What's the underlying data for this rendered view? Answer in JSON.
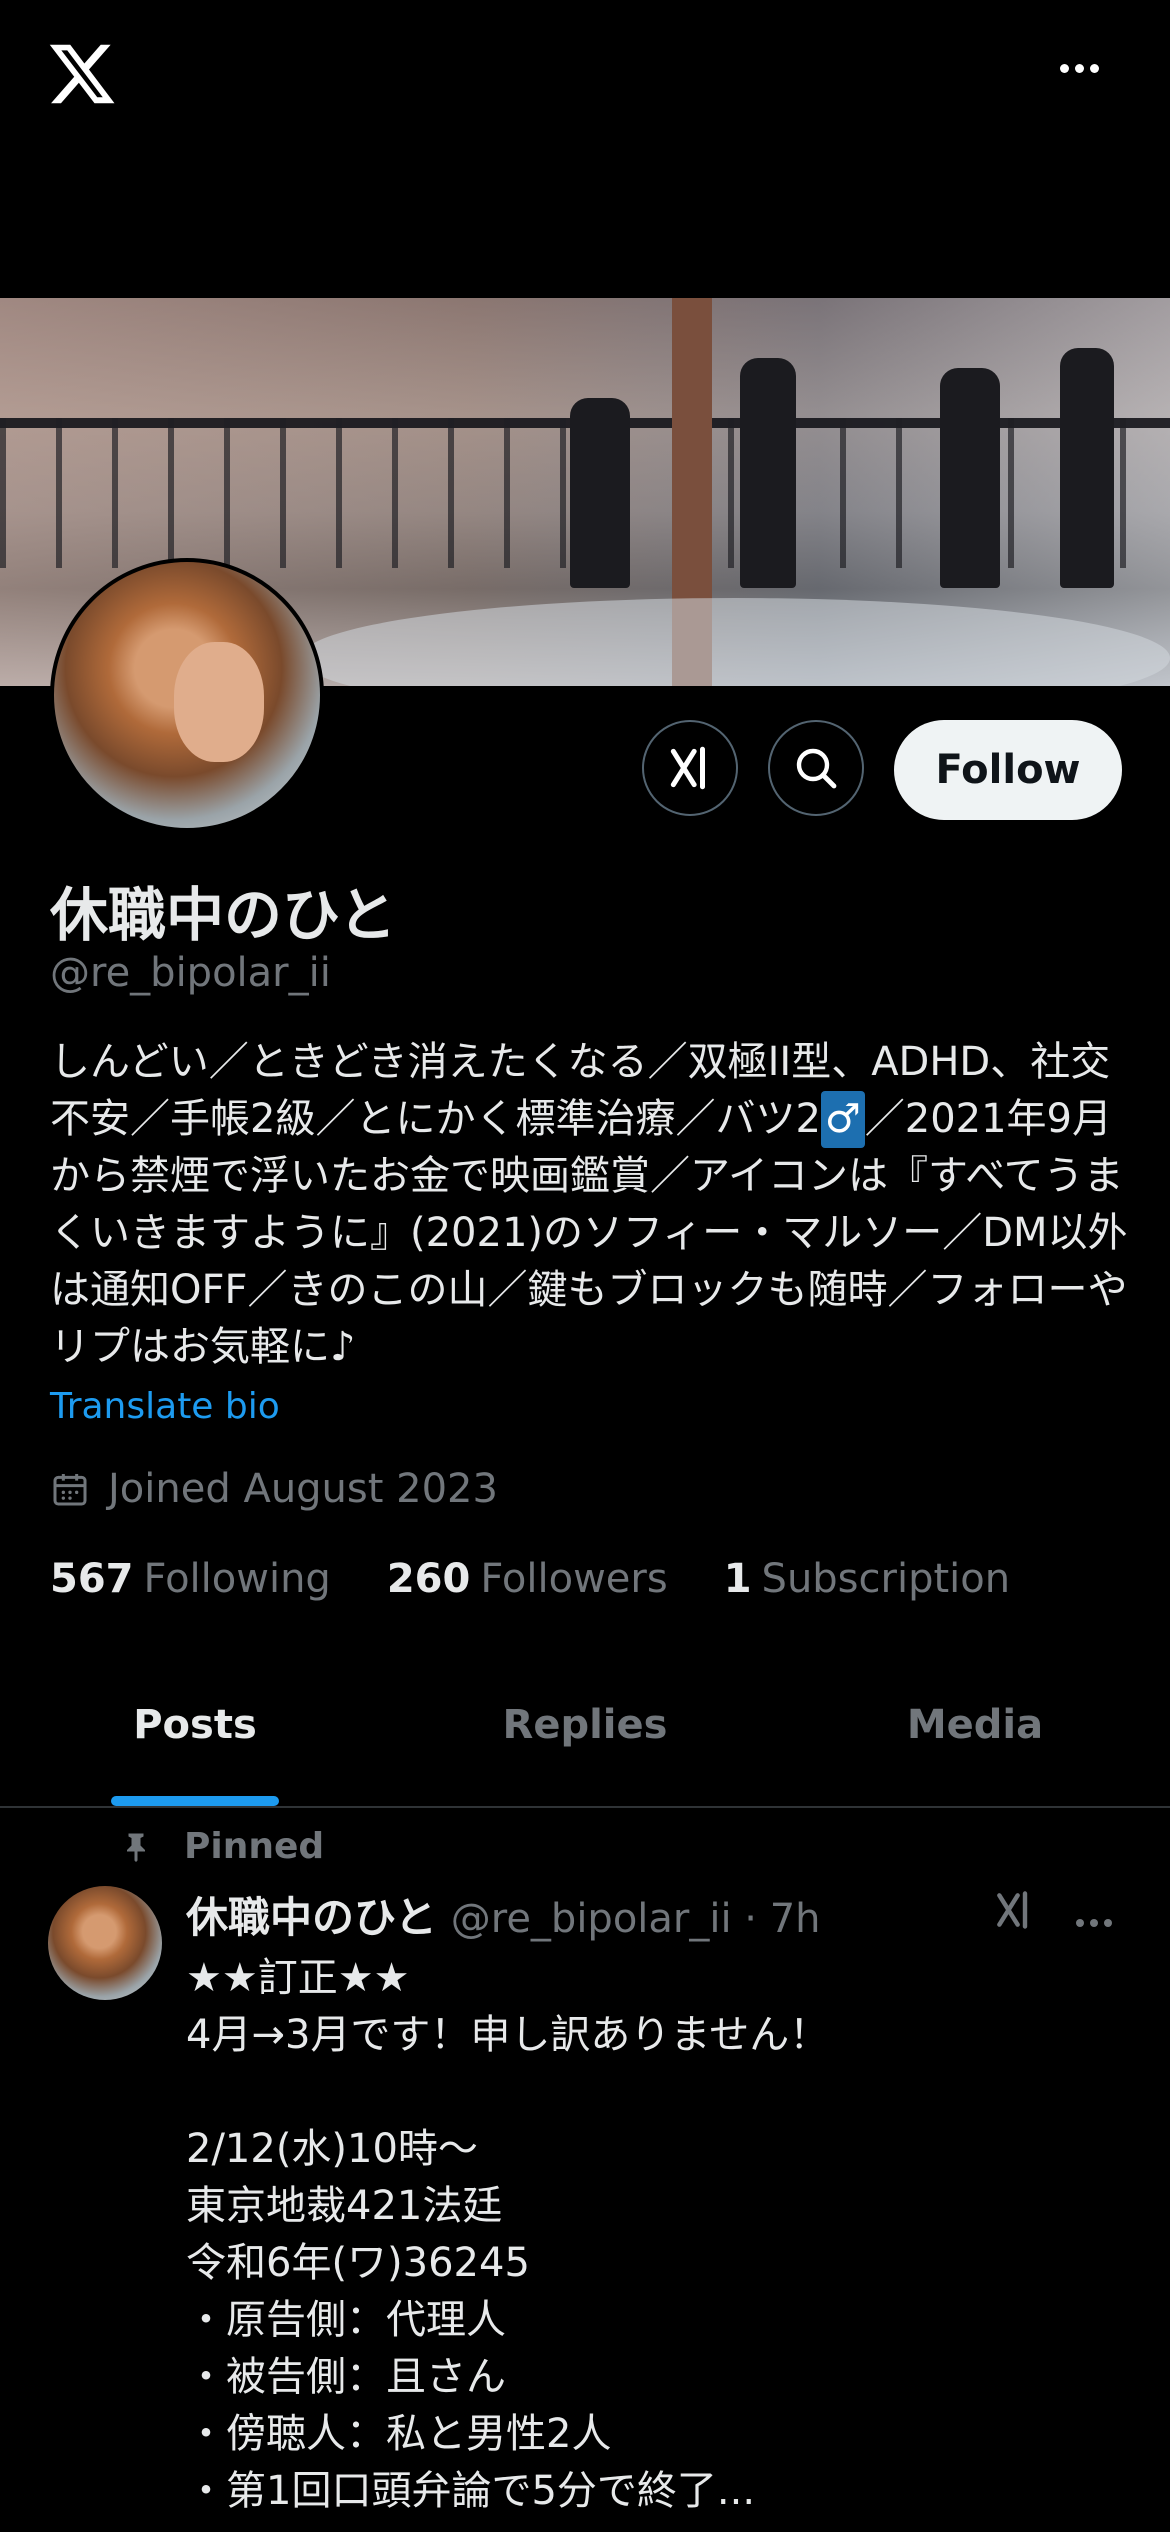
{
  "topbar": {
    "logo_icon": "x-logo-icon",
    "more_icon": "more-horizontal-icon"
  },
  "profile": {
    "name": "休職中のひと",
    "handle": "@re_bipolar_ii",
    "follow_label": "Follow",
    "bio_part1": "しんどい／ときどき消えたくなる／双極II型、ADHD、社交不安／手帳2級／とにかく標準治療／バツ2",
    "bio_symbol": "♂",
    "bio_part2": "／2021年9月から禁煙で浮いたお金で映画鑑賞／アイコンは『すべてうまくいきますように』(2021)のソフィー・マルソー／DM以外は通知OFF／きのこの山／鍵もブロックも随時／フォローやリプはお気軽に♪",
    "translate_label": "Translate bio",
    "joined": "Joined August 2023",
    "following_count": "567",
    "following_label": "Following",
    "followers_count": "260",
    "followers_label": "Followers",
    "subscription_count": "1",
    "subscription_label": "Subscription"
  },
  "tabs": [
    {
      "label": "Posts",
      "active": true
    },
    {
      "label": "Replies",
      "active": false
    },
    {
      "label": "Media",
      "active": false
    }
  ],
  "post": {
    "pinned_label": "Pinned",
    "author_name": "休職中のひと",
    "author_meta": "@re_bipolar_ii · 7h",
    "body": "★★訂正★★\n4月→3月です！申し訳ありません！\n\n2/12(水)10時〜\n東京地裁421法廷\n令和6年(ワ)36245\n・原告側：代理人\n・被告側：且さん\n・傍聴人：私と男性2人\n・第1回口頭弁論で5分で終了..."
  },
  "colors": {
    "accent": "#1d9bf0",
    "muted": "#71767b",
    "text": "#e7e9ea",
    "background": "#000000"
  }
}
